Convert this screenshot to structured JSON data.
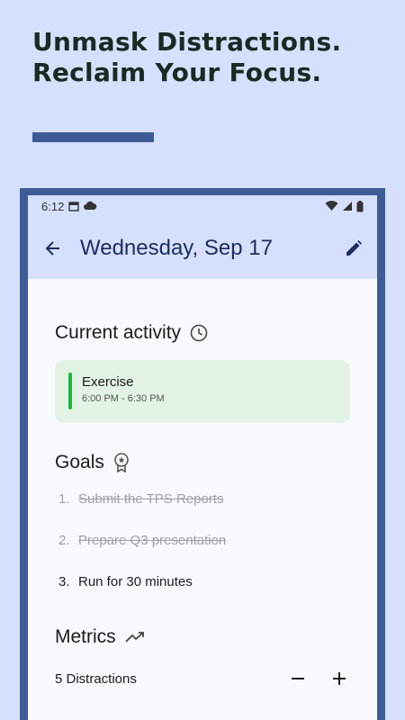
{
  "promo": {
    "headline_line1": "Unmask Distractions.",
    "headline_line2": "Reclaim Your Focus."
  },
  "status_bar": {
    "time": "6:12"
  },
  "app_bar": {
    "title": "Wednesday, Sep 17"
  },
  "current_activity": {
    "title": "Current activity",
    "name": "Exercise",
    "time_range": "6:00 PM - 6:30 PM",
    "accent": "#1fb53a"
  },
  "goals": {
    "title": "Goals",
    "items": [
      {
        "num": "1.",
        "text": "Submit the TPS Reports",
        "done": true
      },
      {
        "num": "2.",
        "text": "Prepare Q3 presentation",
        "done": true
      },
      {
        "num": "3.",
        "text": "Run for 30 minutes",
        "done": false
      }
    ]
  },
  "metrics": {
    "title": "Metrics",
    "distractions_label": "5 Distractions"
  },
  "colors": {
    "background": "#d6e0fd",
    "frame": "#3f5b97",
    "title_text": "#1c2c63"
  },
  "icons": [
    "calendar-icon",
    "cloud-icon",
    "wifi-icon",
    "signal-icon",
    "battery-icon",
    "back-arrow-icon",
    "edit-pencil-icon",
    "clock-icon",
    "award-badge-icon",
    "trending-up-icon",
    "minus-icon",
    "plus-icon"
  ]
}
